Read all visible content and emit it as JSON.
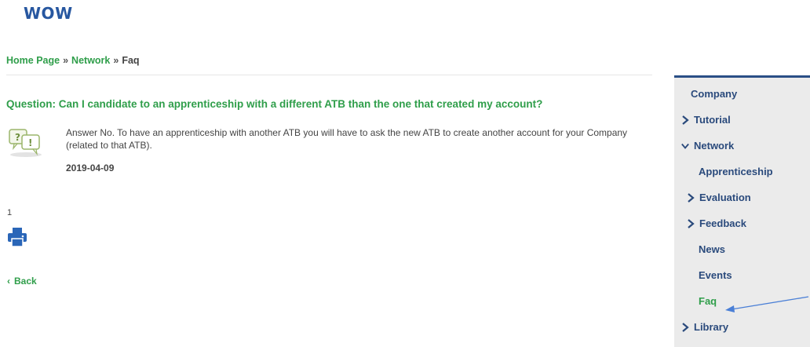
{
  "header": {
    "logo_text": "WOW"
  },
  "breadcrumb": {
    "items": [
      "Home Page",
      "Network"
    ],
    "separator": "»",
    "current": "Faq"
  },
  "faq": {
    "question": "Question: Can I candidate to an apprenticeship with a different ATB than the one that created my account?",
    "answer": "Answer No. To have an apprenticeship with another ATB you will have to ask the new ATB to create another account for your Company (related to that ATB).",
    "date": "2019-04-09"
  },
  "pagination": {
    "page": "1"
  },
  "actions": {
    "back_label": "Back"
  },
  "sidebar": {
    "items": [
      {
        "label": "Company",
        "icon": "none"
      },
      {
        "label": "Tutorial",
        "icon": "chevron-right-icon"
      },
      {
        "label": "Network",
        "icon": "chevron-down-icon"
      },
      {
        "label": "Apprenticeship",
        "icon": "none"
      },
      {
        "label": "Evaluation",
        "icon": "chevron-right-icon"
      },
      {
        "label": "Feedback",
        "icon": "chevron-right-icon"
      },
      {
        "label": "News",
        "icon": "none"
      },
      {
        "label": "Events",
        "icon": "none"
      },
      {
        "label": "Faq",
        "icon": "none",
        "active": true
      },
      {
        "label": "Library",
        "icon": "chevron-right-icon"
      }
    ]
  },
  "colors": {
    "brand_blue": "#2757a0",
    "link_green": "#2f9e4a",
    "sidebar_bg": "#ebebeb",
    "sidebar_text": "#2a4a7c",
    "annotation_arrow": "#4a7fd6"
  }
}
